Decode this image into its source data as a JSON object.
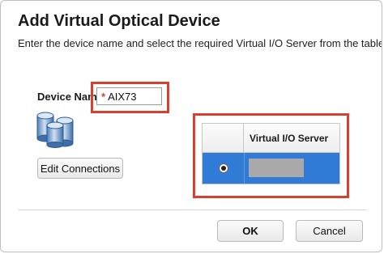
{
  "dialog": {
    "title": "Add Virtual Optical Device",
    "subtitle": "Enter the device name and select the required Virtual I/O Server from the table."
  },
  "device_name": {
    "label": "Device Name",
    "required_marker": "*",
    "value": "AIX73"
  },
  "edit_connections_label": "Edit Connections",
  "vios_table": {
    "column_header": "Virtual I/O Server",
    "rows": [
      {
        "selected": true,
        "name": ""
      }
    ]
  },
  "footer": {
    "ok_label": "OK",
    "cancel_label": "Cancel"
  },
  "colors": {
    "highlight_red": "#d6402f",
    "row_selected_blue": "#2f7bd6"
  },
  "icons": {
    "device": "database-storage-icon"
  }
}
